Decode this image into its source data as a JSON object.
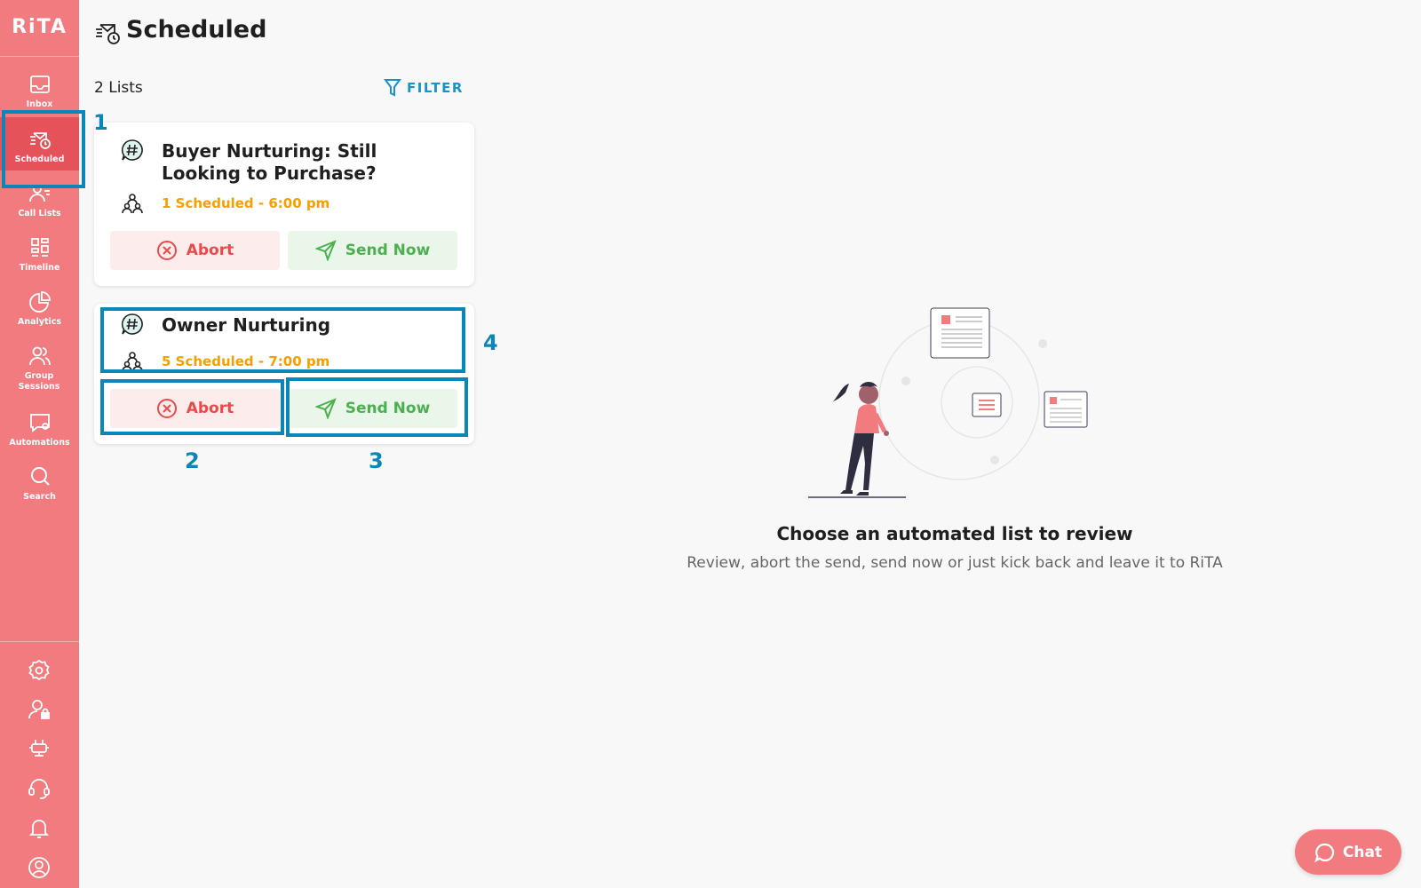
{
  "app": {
    "logo": "RiTA"
  },
  "sidebar": {
    "items": [
      {
        "label": "Inbox",
        "icon": "inbox-icon"
      },
      {
        "label": "Scheduled",
        "icon": "scheduled-icon",
        "active": true
      },
      {
        "label": "Call Lists",
        "icon": "call-lists-icon"
      },
      {
        "label": "Timeline",
        "icon": "timeline-icon"
      },
      {
        "label": "Analytics",
        "icon": "analytics-icon"
      },
      {
        "label": "Group Sessions",
        "icon": "group-sessions-icon"
      },
      {
        "label": "Automations",
        "icon": "automations-icon"
      },
      {
        "label": "Search",
        "icon": "search-icon"
      }
    ],
    "bottom_icons": [
      "settings-icon",
      "user-lock-icon",
      "plug-icon",
      "headset-icon",
      "bell-icon",
      "profile-icon"
    ]
  },
  "header": {
    "title": "Scheduled"
  },
  "list_header": {
    "count": "2 Lists",
    "filter_label": "FILTER"
  },
  "cards": [
    {
      "title": "Buyer Nurturing: Still Looking to Purchase?",
      "scheduled": "1 Scheduled - 6:00 pm",
      "abort_label": "Abort",
      "send_label": "Send Now"
    },
    {
      "title": "Owner Nurturing",
      "scheduled": "5 Scheduled - 7:00 pm",
      "abort_label": "Abort",
      "send_label": "Send Now"
    }
  ],
  "annotations": [
    "1",
    "2",
    "3",
    "4"
  ],
  "empty_state": {
    "title": "Choose an automated list to review",
    "subtitle": "Review, abort the send, send now or just kick back and leave it to RiTA"
  },
  "chat": {
    "label": "Chat"
  },
  "colors": {
    "sidebar": "#f27b80",
    "active": "#e5525a",
    "accent": "#1a93c7",
    "scheduled": "#f5a000",
    "abort": "#e94b4b",
    "send": "#4caf50",
    "annotation": "#0b86b8"
  }
}
